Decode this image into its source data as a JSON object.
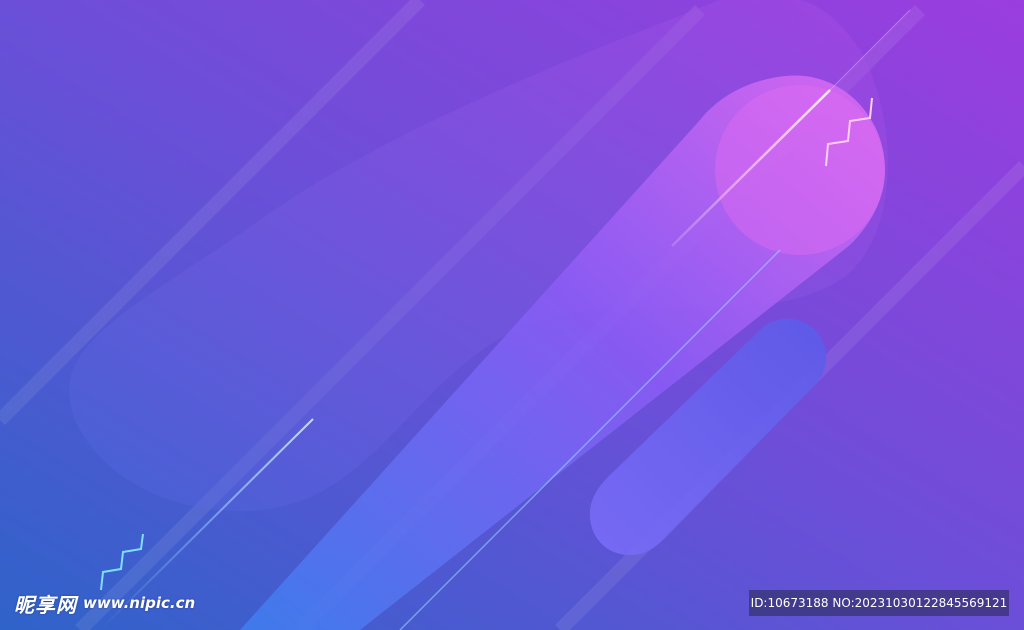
{
  "watermark": {
    "site_name": "昵享网",
    "site_url": "www.nipic.cn",
    "id_text": "ID:10673188 NO:20231030122845569121"
  },
  "colors": {
    "bg_top_right": "#9b3ddf",
    "bg_mid": "#6b4fd8",
    "bg_bottom_left": "#2f63c9",
    "pill_pink": "#d86bf0",
    "pill_blue": "#3f7ff0"
  },
  "scene": {
    "description_icons": [
      "zigzag-sparkle-icon",
      "diagonal-streak-icon"
    ]
  }
}
